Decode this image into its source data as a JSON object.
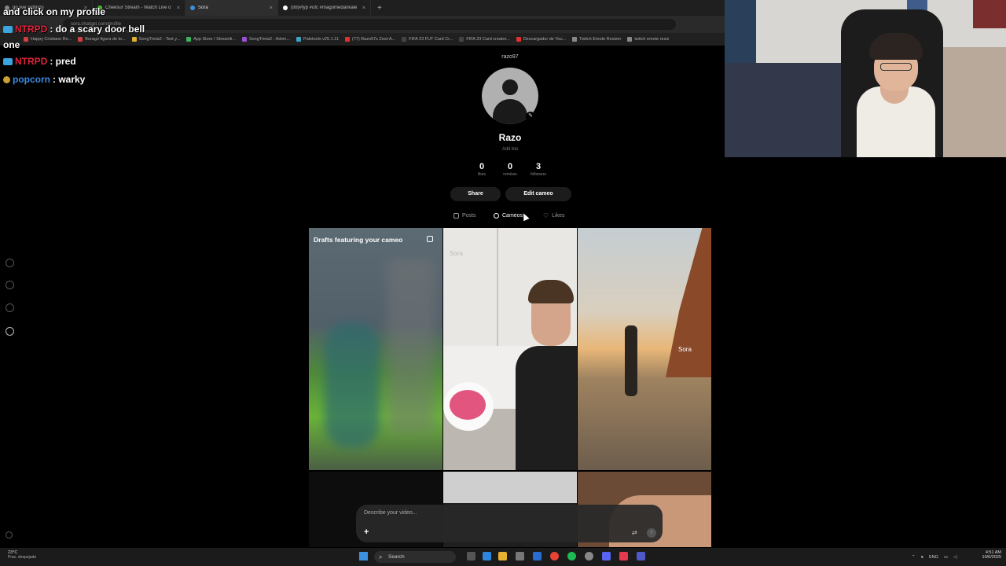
{
  "browser": {
    "tabs": [
      {
        "label": "go live settings",
        "color": "#888888",
        "active": false
      },
      {
        "label": "Cheesur Stream - Watch Live o",
        "color": "#4fbf3a",
        "active": false
      },
      {
        "label": "Sora",
        "color": "#3d8fe0",
        "active": true
      },
      {
        "label": "(88)#fyp #ufc #magomedankale",
        "color": "#ffffff",
        "active": false
      }
    ],
    "new_tab": "+",
    "url": "sora.chatgpt.com/profile",
    "bookmarks": [
      {
        "label": "Happy Cristiano Ro...",
        "color": "#d04040"
      },
      {
        "label": "Burago figura de to...",
        "color": "#d04040"
      },
      {
        "label": "SongTrivia2 - Test y...",
        "color": "#e0b030"
      },
      {
        "label": "App Store / Streamli...",
        "color": "#3ab060"
      },
      {
        "label": "SongTrivia2 - Advin...",
        "color": "#9a50d0"
      },
      {
        "label": "Paletools v25.1.11",
        "color": "#40a0c0"
      },
      {
        "label": "(77) Razo97s Zest-A...",
        "color": "#e03030"
      },
      {
        "label": "FIFA 23 FUT Card Cr...",
        "color": "#444444"
      },
      {
        "label": "FIFA 23 Card creator...",
        "color": "#444444"
      },
      {
        "label": "Descargador de You...",
        "color": "#e03030"
      },
      {
        "label": "Twitch Emote Resizer",
        "color": "#888888"
      },
      {
        "label": "twitch emote resiz",
        "color": "#888888"
      }
    ]
  },
  "chat": [
    {
      "user": "",
      "message": "and click on my profile",
      "user_color": "#ffffff"
    },
    {
      "user": "NTRPD",
      "message": ": do a scary door bell",
      "user_color": "#e0243a"
    },
    {
      "user": "",
      "message": "one",
      "user_color": "#ffffff"
    },
    {
      "user": "NTRPD",
      "message": ": pred",
      "user_color": "#e0243a"
    },
    {
      "user": "popcorn",
      "message": ": warky",
      "user_color": "#3a8ae0"
    }
  ],
  "profile": {
    "handle": "razo97",
    "name": "Razo",
    "bio_placeholder": "Add bio",
    "stats": [
      {
        "value": "0",
        "label": "likes"
      },
      {
        "value": "0",
        "label": "remixes"
      },
      {
        "value": "3",
        "label": "followers"
      }
    ],
    "share_label": "Share",
    "edit_cameo_label": "Edit cameo",
    "tabs": [
      {
        "label": "Posts",
        "active": false
      },
      {
        "label": "Cameos",
        "active": true
      },
      {
        "label": "Likes",
        "active": false
      }
    ]
  },
  "grid": {
    "drafts_title": "Drafts featuring your cameo",
    "watermark": "Sora"
  },
  "composer": {
    "placeholder": "Describe your video...",
    "add_label": "+",
    "settings_icon": "sliders-icon",
    "send_icon": "arrow-up-icon"
  },
  "taskbar": {
    "temperature": "23°C",
    "weather": "Prac. despejado",
    "search_label": "Search",
    "language": "ENG",
    "time": "4:51 AM",
    "date": "10/6/2025"
  }
}
